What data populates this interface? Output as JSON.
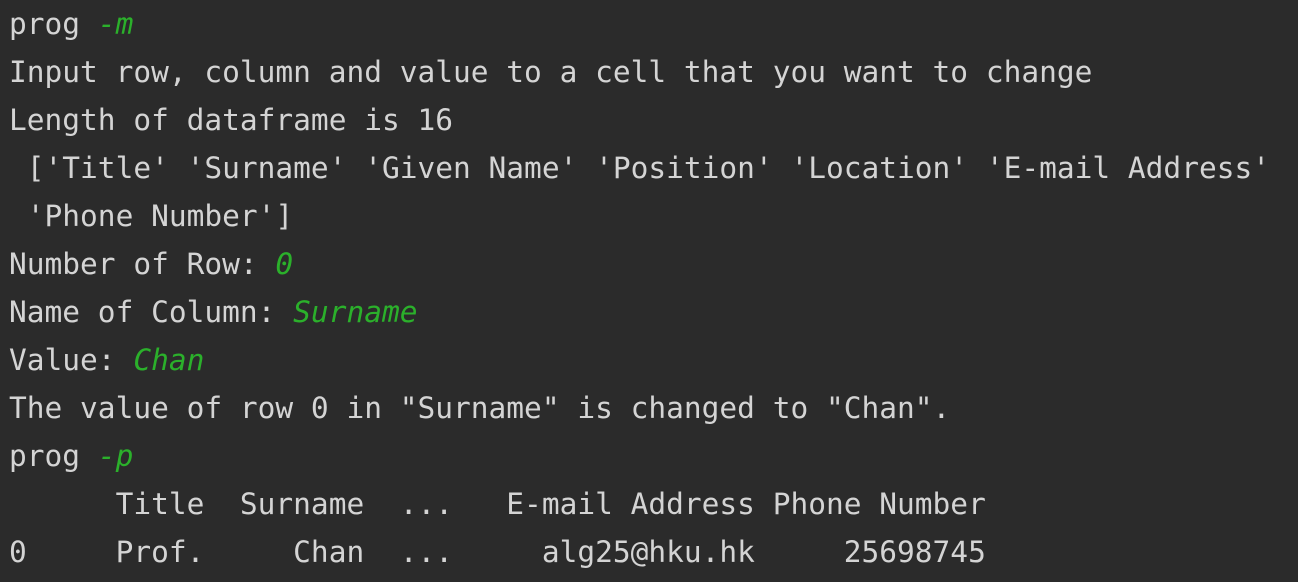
{
  "colors": {
    "background": "#2b2b2b",
    "output_text": "#d4d4d4",
    "user_input": "#2bb02b"
  },
  "console": {
    "lines": [
      {
        "prompt": "prog ",
        "input": "-m"
      },
      {
        "text": "Input row, column and value to a cell that you want to change"
      },
      {
        "text": "Length of dataframe is 16"
      },
      {
        "text": " ['Title' 'Surname' 'Given Name' 'Position' 'Location' 'E-mail Address'"
      },
      {
        "text": " 'Phone Number']"
      },
      {
        "prompt": "Number of Row: ",
        "input": "0"
      },
      {
        "prompt": "Name of Column: ",
        "input": "Surname"
      },
      {
        "prompt": "Value: ",
        "input": "Chan"
      },
      {
        "text": "The value of row 0 in \"Surname\" is changed to \"Chan\"."
      },
      {
        "prompt": "prog ",
        "input": "-p"
      },
      {
        "text": "      Title  Surname  ...   E-mail Address Phone Number"
      },
      {
        "text": "0     Prof.     Chan  ...     alg25@hku.hk     25698745"
      }
    ]
  }
}
